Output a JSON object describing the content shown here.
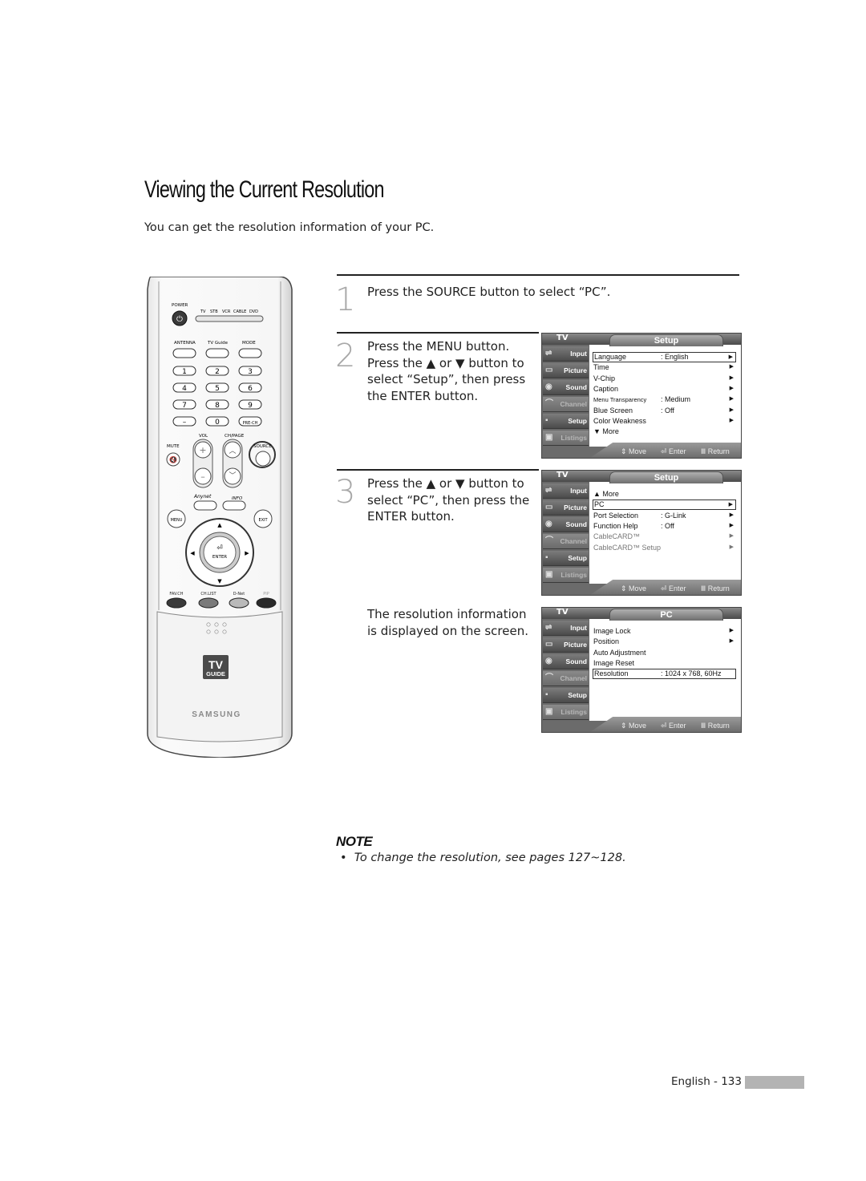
{
  "page": {
    "title": "Viewing the Current Resolution",
    "intro": "You can get the resolution information of your PC."
  },
  "steps": [
    {
      "number": "1",
      "lines": [
        "Press the SOURCE button to select “PC”."
      ]
    },
    {
      "number": "2",
      "lines": [
        "Press the MENU button.",
        "Press the ▲ or ▼ button to",
        "select “Setup”, then press",
        "the ENTER button."
      ]
    },
    {
      "number": "3",
      "lines": [
        "Press the ▲ or ▼ button to",
        "select “PC”, then press the",
        "ENTER button."
      ]
    },
    {
      "number": "",
      "lines": [
        "The resolution information",
        "is displayed on the screen."
      ]
    }
  ],
  "osd_common": {
    "tv_label": "TV",
    "sidebar": [
      {
        "label": "Input",
        "icon": "input-icon"
      },
      {
        "label": "Picture",
        "icon": "picture-icon"
      },
      {
        "label": "Sound",
        "icon": "sound-icon"
      },
      {
        "label": "Channel",
        "icon": "channel-icon"
      },
      {
        "label": "Setup",
        "icon": "setup-icon"
      },
      {
        "label": "Listings",
        "icon": "tv-guide-icon"
      }
    ],
    "hints": {
      "move": "Move",
      "enter": "Enter",
      "return": "Return"
    }
  },
  "osd_screens": [
    {
      "header": "Setup",
      "active_sidebar": "Setup",
      "rows": [
        {
          "label": "Language",
          "value": ": English",
          "arrow": true,
          "selected": true
        },
        {
          "label": "Time",
          "value": "",
          "arrow": true
        },
        {
          "label": "V-Chip",
          "value": "",
          "arrow": true
        },
        {
          "label": "Caption",
          "value": "",
          "arrow": true
        },
        {
          "label": "Menu Transparency",
          "value": ": Medium",
          "arrow": true,
          "small": true
        },
        {
          "label": "Blue Screen",
          "value": ": Off",
          "arrow": true
        },
        {
          "label": "Color Weakness",
          "value": "",
          "arrow": true
        },
        {
          "label": "▼ More",
          "value": "",
          "arrow": false
        }
      ]
    },
    {
      "header": "Setup",
      "active_sidebar": "Setup",
      "rows": [
        {
          "label": "▲ More",
          "value": "",
          "arrow": false
        },
        {
          "label": "PC",
          "value": "",
          "arrow": true,
          "selected": true
        },
        {
          "label": "Port Selection",
          "value": ": G-Link",
          "arrow": true
        },
        {
          "label": "Function Help",
          "value": ": Off",
          "arrow": true
        },
        {
          "label": "CableCARD™",
          "value": "",
          "arrow": true,
          "gray": true
        },
        {
          "label": "CableCARD™ Setup",
          "value": "",
          "arrow": true,
          "gray": true
        }
      ]
    },
    {
      "header": "PC",
      "active_sidebar": "Setup",
      "rows": [
        {
          "label": "Image Lock",
          "value": "",
          "arrow": true
        },
        {
          "label": "Position",
          "value": "",
          "arrow": true
        },
        {
          "label": "Auto Adjustment",
          "value": "",
          "arrow": false
        },
        {
          "label": "Image Reset",
          "value": "",
          "arrow": false
        },
        {
          "label": "Resolution",
          "value": ": 1024 x 768, 60Hz",
          "arrow": false,
          "selected": true
        }
      ]
    }
  ],
  "remote": {
    "power": "POWER",
    "modes": [
      "TV",
      "STB",
      "VCR",
      "CABLE",
      "DVD"
    ],
    "top_row": [
      "ANTENNA",
      "TV Guide",
      "MODE"
    ],
    "digits": [
      "1",
      "2",
      "3",
      "4",
      "5",
      "6",
      "7",
      "8",
      "9",
      "–",
      "0",
      "PRE-CH"
    ],
    "vol": "VOL",
    "chpage": "CH/PAGE",
    "mute": "MUTE",
    "source": "SOURCE",
    "anynet": "Anynet",
    "info": "INFO",
    "menu": "MENU",
    "exit": "EXIT",
    "enter": "ENTER",
    "color_buttons": [
      {
        "label": "FAV.CH",
        "color": "#3a3a3a"
      },
      {
        "label": "CH.LIST",
        "color": "#7a7a7a"
      },
      {
        "label": "D-Net",
        "color": "#b9b9b9"
      },
      {
        "label": "PIP",
        "color": "#2a2a2a"
      }
    ],
    "tvguide_logo": [
      "TV",
      "GUIDE"
    ],
    "brand": "SAMSUNG"
  },
  "note": {
    "title": "NOTE",
    "items": [
      "To change the resolution, see pages 127~128."
    ]
  },
  "footer": {
    "page_label": "English - 133"
  }
}
